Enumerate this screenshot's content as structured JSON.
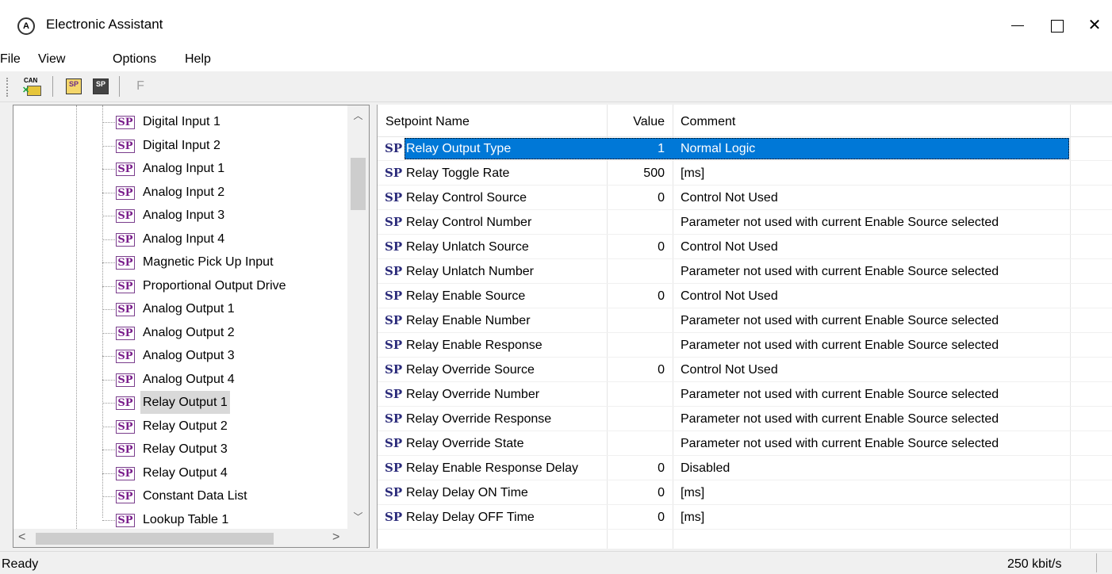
{
  "window": {
    "title": "Electronic Assistant",
    "app_icon": "app-logo-icon",
    "minimize_icon": "minimize-icon",
    "maximize_icon": "maximize-icon",
    "close_glyph": "✕"
  },
  "menu": {
    "items": [
      {
        "label": "File"
      },
      {
        "label": "View"
      },
      {
        "label": "Options"
      },
      {
        "label": "Help"
      }
    ]
  },
  "toolbar": {
    "can_label": "CAN",
    "sp_label": "SP",
    "f_label": "F",
    "icons": [
      "can-connect-icon",
      "open-setpoint-file-icon",
      "save-setpoint-file-icon",
      "flash-icon"
    ]
  },
  "tree": {
    "sp_badge": "SP",
    "selected_index": 12,
    "items": [
      {
        "label": "Digital Input 1"
      },
      {
        "label": "Digital Input 2"
      },
      {
        "label": "Analog Input 1"
      },
      {
        "label": "Analog Input 2"
      },
      {
        "label": "Analog Input 3"
      },
      {
        "label": "Analog Input 4"
      },
      {
        "label": "Magnetic Pick Up Input"
      },
      {
        "label": "Proportional Output Drive"
      },
      {
        "label": "Analog Output 1"
      },
      {
        "label": "Analog Output 2"
      },
      {
        "label": "Analog Output 3"
      },
      {
        "label": "Analog Output 4"
      },
      {
        "label": "Relay Output 1"
      },
      {
        "label": "Relay Output 2"
      },
      {
        "label": "Relay Output 3"
      },
      {
        "label": "Relay Output 4"
      },
      {
        "label": "Constant Data List"
      },
      {
        "label": "Lookup Table 1"
      }
    ],
    "scroll": {
      "up": "^",
      "down": "v",
      "left": "<",
      "right": ">"
    }
  },
  "table": {
    "headers": {
      "name": "Setpoint Name",
      "value": "Value",
      "comment": "Comment"
    },
    "sp_badge": "SP",
    "selected_index": 0,
    "rows": [
      {
        "name": "Relay Output Type",
        "value": "1",
        "comment": "Normal Logic"
      },
      {
        "name": "Relay Toggle Rate",
        "value": "500",
        "comment": "[ms]"
      },
      {
        "name": "Relay Control Source",
        "value": "0",
        "comment": "Control Not Used"
      },
      {
        "name": "Relay Control Number",
        "value": "",
        "comment": "Parameter not used with current Enable Source selected"
      },
      {
        "name": "Relay Unlatch Source",
        "value": "0",
        "comment": "Control Not Used"
      },
      {
        "name": "Relay Unlatch Number",
        "value": "",
        "comment": "Parameter not used with current Enable Source selected"
      },
      {
        "name": "Relay Enable Source",
        "value": "0",
        "comment": "Control Not Used"
      },
      {
        "name": "Relay Enable Number",
        "value": "",
        "comment": "Parameter not used with current Enable Source selected"
      },
      {
        "name": "Relay Enable Response",
        "value": "",
        "comment": "Parameter not used with current Enable Source selected"
      },
      {
        "name": "Relay Override Source",
        "value": "0",
        "comment": "Control Not Used"
      },
      {
        "name": "Relay Override Number",
        "value": "",
        "comment": "Parameter not used with current Enable Source selected"
      },
      {
        "name": "Relay Override Response",
        "value": "",
        "comment": "Parameter not used with current Enable Source selected"
      },
      {
        "name": "Relay Override State",
        "value": "",
        "comment": "Parameter not used with current Enable Source selected"
      },
      {
        "name": "Relay Enable Response Delay",
        "value": "0",
        "comment": "Disabled"
      },
      {
        "name": "Relay Delay ON Time",
        "value": "0",
        "comment": "[ms]"
      },
      {
        "name": "Relay Delay OFF Time",
        "value": "0",
        "comment": "[ms]"
      }
    ]
  },
  "status": {
    "text": "Ready",
    "baud_rate": "250 kbit/s"
  },
  "colors": {
    "selection": "#0078d7",
    "sp_badge": "#7a1f8c"
  }
}
